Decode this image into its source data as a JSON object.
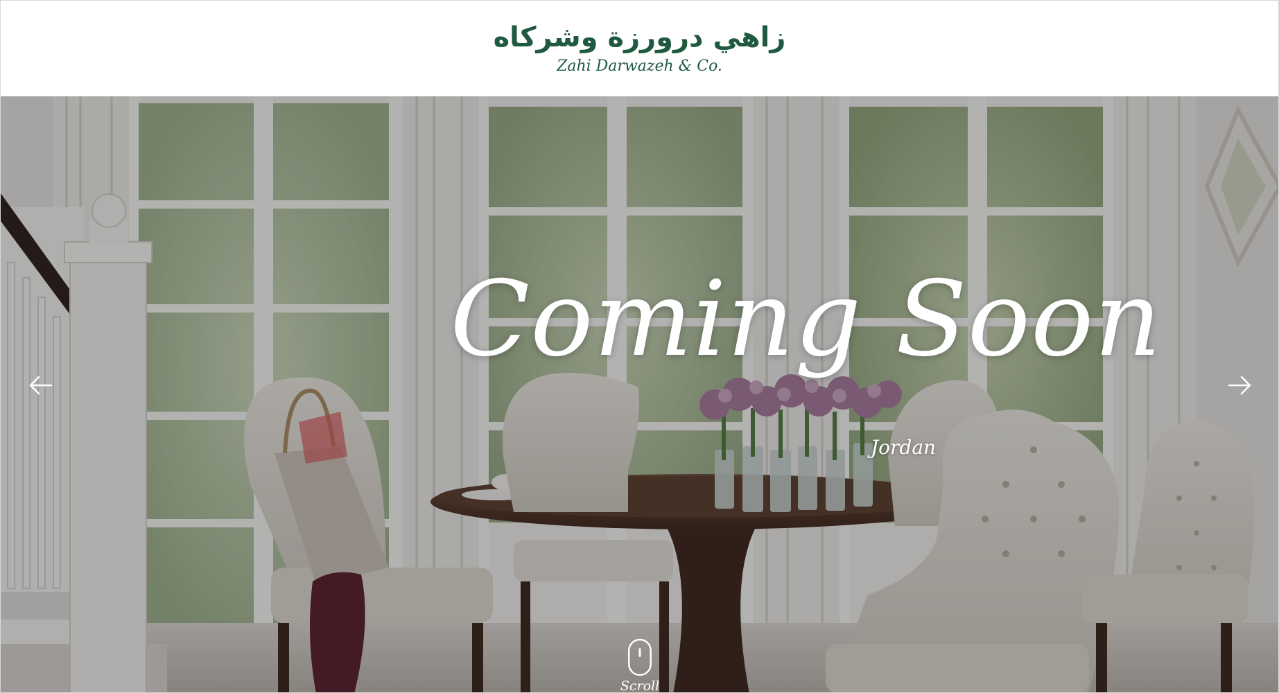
{
  "header": {
    "logo_arabic": "زاهي درورزة وشركاه",
    "logo_latin": "Zahi Darwazeh & Co."
  },
  "hero": {
    "title": "Coming Soon",
    "subtitle": "Jordan",
    "scroll_label": "Scroll"
  },
  "icons": {
    "prev": "arrow-left-icon",
    "next": "arrow-right-icon",
    "scroll": "mouse-icon"
  },
  "colors": {
    "brand_green": "#1f5a40",
    "hero_text": "#ffffff"
  }
}
